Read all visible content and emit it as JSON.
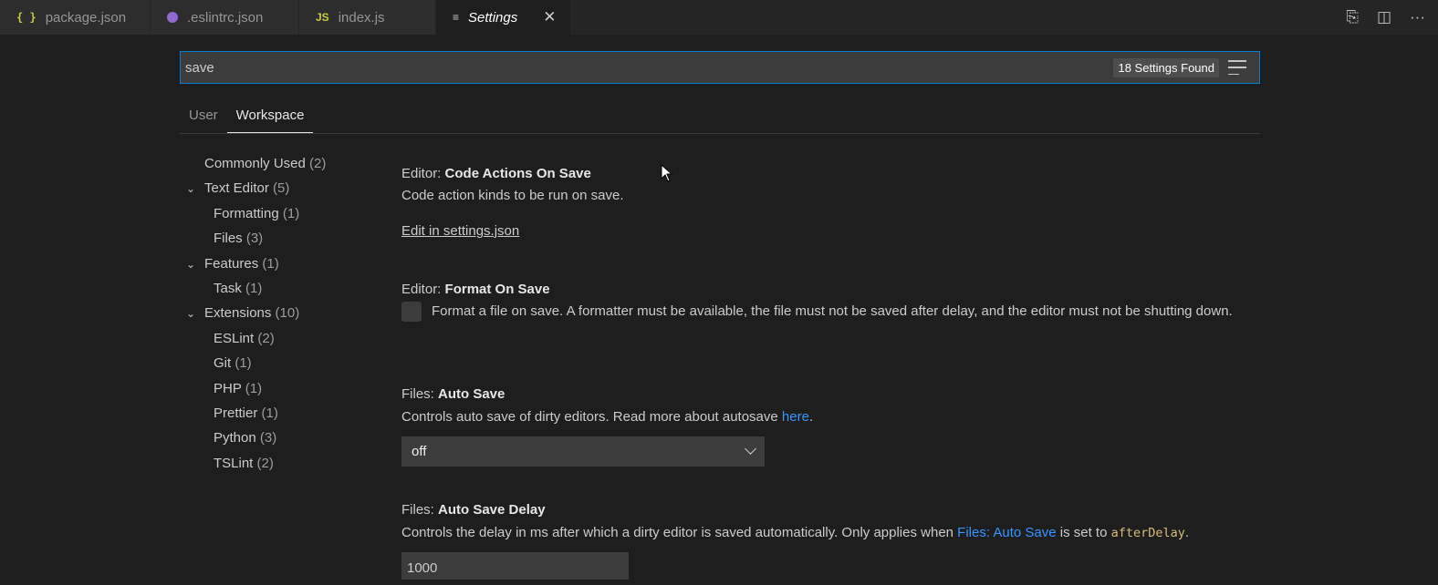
{
  "tabs": [
    {
      "icon": "{ }",
      "label": "package.json"
    },
    {
      "icon": "",
      "label": ".eslintrc.json"
    },
    {
      "icon": "JS",
      "label": "index.js"
    },
    {
      "icon": "≡",
      "label": "Settings",
      "close": "✕"
    }
  ],
  "toolbar": {
    "open_json_icon": "⎘",
    "split_icon": "◫",
    "more_icon": "···"
  },
  "search": {
    "value": "save",
    "count": "18 Settings Found"
  },
  "scopes": [
    "User",
    "Workspace"
  ],
  "toc": [
    {
      "label": "Commonly Used",
      "count": "(2)"
    },
    {
      "label": "Text Editor",
      "count": "(5)"
    },
    {
      "label": "Formatting",
      "count": "(1)"
    },
    {
      "label": "Files",
      "count": "(3)"
    },
    {
      "label": "Features",
      "count": "(1)"
    },
    {
      "label": "Task",
      "count": "(1)"
    },
    {
      "label": "Extensions",
      "count": "(10)"
    },
    {
      "label": "ESLint",
      "count": "(2)"
    },
    {
      "label": "Git",
      "count": "(1)"
    },
    {
      "label": "PHP",
      "count": "(1)"
    },
    {
      "label": "Prettier",
      "count": "(1)"
    },
    {
      "label": "Python",
      "count": "(3)"
    },
    {
      "label": "TSLint",
      "count": "(2)"
    }
  ],
  "settings": {
    "code_actions": {
      "category": "Editor: ",
      "name": "Code Actions On Save",
      "desc": "Code action kinds to be run on save.",
      "edit_link": "Edit in settings.json"
    },
    "format_on_save": {
      "category": "Editor: ",
      "name": "Format On Save",
      "desc": "Format a file on save. A formatter must be available, the file must not be saved after delay, and the editor must not be shutting down.",
      "checked": false
    },
    "auto_save": {
      "category": "Files: ",
      "name": "Auto Save",
      "desc_pre": "Controls auto save of dirty editors. Read more about autosave ",
      "desc_link": "here",
      "desc_post": ".",
      "value": "off"
    },
    "auto_save_delay": {
      "category": "Files: ",
      "name": "Auto Save Delay",
      "desc_pre": "Controls the delay in ms after which a dirty editor is saved automatically. Only applies when ",
      "desc_link": "Files: Auto Save",
      "desc_mid": " is set to ",
      "desc_code": "afterDelay",
      "desc_post": ".",
      "value": "1000"
    }
  }
}
